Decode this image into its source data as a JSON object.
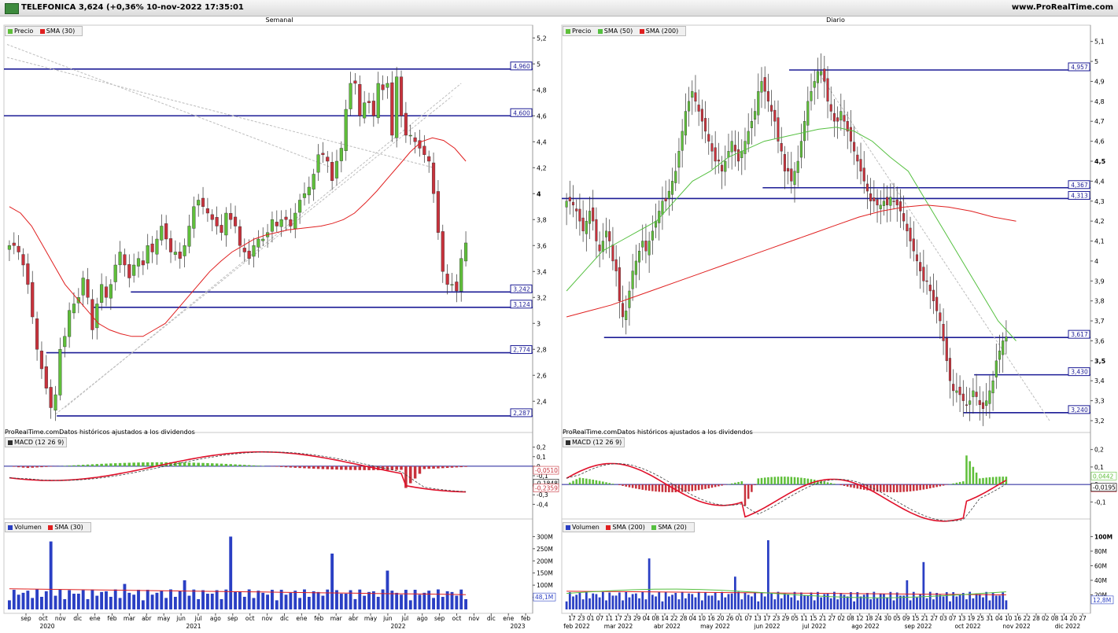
{
  "window": {
    "title": "TELEFONICA 3,624 (+0,36% 10-nov-2022 17:35:01",
    "site": "www.ProRealTime.com"
  },
  "colors": {
    "up": "#5fbf3a",
    "down": "#c8323c",
    "sma_red": "#e02020",
    "sma_green": "#55c040",
    "level_line": "#1c1c96",
    "trend_dotted": "#bdbdbd",
    "macd_line": "#e0102a",
    "signal_line": "#404040",
    "volume": "#2a3fc4"
  },
  "weekly": {
    "title": "Semanal",
    "legend": [
      {
        "label": "Precio",
        "color": "#5fbf3a"
      },
      {
        "label": "SMA (30)",
        "color": "#e02020"
      }
    ],
    "y_ticks": [
      "5,2",
      "5",
      "4,8",
      "4,6",
      "4,4",
      "4,2",
      "4",
      "3,8",
      "3,6",
      "3,4",
      "3,2",
      "3",
      "2,8",
      "2,6",
      "2,4"
    ],
    "levels": [
      "4,960",
      "4,600",
      "3,242",
      "3,124",
      "2,774",
      "2,287"
    ],
    "source": "ProRealTime.comDatos históricos ajustados a los dividendos",
    "macd_legend": "MACD (12 26 9)",
    "macd_ticks": [
      "0,2",
      "0,1",
      "0",
      "-0,1",
      "-0,2",
      "-0,3",
      "-0,4"
    ],
    "macd_values": [
      "-0,0510",
      "-0,1848",
      "-0,2359"
    ],
    "vol_legend": [
      {
        "label": "Volumen",
        "color": "#2a3fc4"
      },
      {
        "label": "SMA (30)",
        "color": "#e02020"
      }
    ],
    "vol_ticks": [
      "300M",
      "250M",
      "200M",
      "150M",
      "100M",
      "50M"
    ],
    "vol_value": "48,1M",
    "x_months": [
      "sep",
      "oct",
      "nov",
      "dic",
      "ene",
      "feb",
      "mar",
      "abr",
      "may",
      "jun",
      "jul",
      "ago",
      "sep",
      "oct",
      "nov",
      "dic",
      "ene",
      "feb",
      "mar",
      "abr",
      "may",
      "jun",
      "jul",
      "ago",
      "sep",
      "oct",
      "nov",
      "dic",
      "ene",
      "feb"
    ],
    "x_years": [
      "2020",
      "2021",
      "2022",
      "2023"
    ]
  },
  "daily": {
    "title": "Diario",
    "legend": [
      {
        "label": "Precio",
        "color": "#5fbf3a"
      },
      {
        "label": "SMA (50)",
        "color": "#55c040"
      },
      {
        "label": "SMA (200)",
        "color": "#e02020"
      }
    ],
    "y_ticks": [
      "5,1",
      "5",
      "4,9",
      "4,8",
      "4,7",
      "4,6",
      "4,5",
      "4,4",
      "4,3",
      "4,2",
      "4,1",
      "4",
      "3,9",
      "3,8",
      "3,7",
      "3,6",
      "3,5",
      "3,4",
      "3,3",
      "3,2"
    ],
    "levels": [
      "4,957",
      "4,367",
      "4,313",
      "3,617",
      "3,430",
      "3,240"
    ],
    "source": "ProRealTime.comDatos históricos ajustados a los dividendos",
    "macd_legend": "MACD (12 26 9)",
    "macd_ticks": [
      "0,2",
      "0,1",
      "0",
      "-0,1"
    ],
    "macd_values": [
      "0,0442",
      "-0,0247",
      "-0,0195"
    ],
    "vol_legend": [
      {
        "label": "Volumen",
        "color": "#2a3fc4"
      },
      {
        "label": "SMA (200)",
        "color": "#e02020"
      },
      {
        "label": "SMA (20)",
        "color": "#55c040"
      }
    ],
    "vol_ticks": [
      "100M",
      "80M",
      "60M",
      "40M",
      "20M"
    ],
    "vol_value": "12,8M",
    "x_days": [
      "17",
      "23",
      "01",
      "07",
      "11",
      "17",
      "23",
      "29",
      "04",
      "08",
      "14",
      "22",
      "28",
      "04",
      "10",
      "16",
      "20",
      "26",
      "01",
      "07",
      "13",
      "17",
      "23",
      "29",
      "05",
      "11",
      "15",
      "21",
      "27",
      "02",
      "08",
      "12",
      "18",
      "24",
      "30",
      "05",
      "09",
      "15",
      "21",
      "27",
      "03",
      "07",
      "13",
      "19",
      "25",
      "31",
      "04",
      "10",
      "16",
      "22",
      "28",
      "02",
      "08",
      "14",
      "20",
      "27"
    ],
    "x_months": [
      "feb 2022",
      "mar 2022",
      "abr 2022",
      "may 2022",
      "jun 2022",
      "jul 2022",
      "ago 2022",
      "sep 2022",
      "oct 2022",
      "nov 2022",
      "dic 2022"
    ]
  },
  "chart_data": [
    {
      "type": "candlestick",
      "title": "Semanal",
      "series": [
        {
          "name": "Precio",
          "values": [
            3.6,
            3.6,
            3.55,
            3.45,
            3.3,
            3.05,
            2.8,
            2.65,
            2.5,
            2.35,
            2.45,
            2.8,
            2.9,
            3.1,
            3.15,
            3.2,
            3.35,
            3.2,
            2.95,
            3.15,
            3.3,
            3.2,
            3.3,
            3.45,
            3.55,
            3.45,
            3.35,
            3.45,
            3.5,
            3.45,
            3.6,
            3.55,
            3.65,
            3.75,
            3.65,
            3.55,
            3.55,
            3.5,
            3.6,
            3.75,
            3.9,
            3.95,
            3.9,
            3.85,
            3.8,
            3.75,
            3.7,
            3.85,
            3.8,
            3.75,
            3.6,
            3.55,
            3.5,
            3.6,
            3.65,
            3.65,
            3.7,
            3.8,
            3.75,
            3.8,
            3.8,
            3.75,
            3.85,
            3.95,
            4,
            4.05,
            4.15,
            4.3,
            4.3,
            4.25,
            4.1,
            4.25,
            4.35,
            4.65,
            4.85,
            4.85,
            4.6,
            4.7,
            4.7,
            4.6,
            4.85,
            4.8,
            4.85,
            4.45,
            4.9,
            4.6,
            4.45,
            4.45,
            4.4,
            4.35,
            4.3,
            4.25,
            4.0,
            3.7,
            3.4,
            3.3,
            3.3,
            3.25,
            3.5,
            3.62
          ]
        },
        {
          "name": "SMA (30)",
          "values": [
            3.9,
            3.85,
            3.75,
            3.6,
            3.45,
            3.3,
            3.2,
            3.1,
            3.0,
            2.95,
            2.92,
            2.9,
            2.9,
            2.95,
            3.0,
            3.1,
            3.2,
            3.3,
            3.4,
            3.48,
            3.55,
            3.6,
            3.65,
            3.68,
            3.7,
            3.72,
            3.73,
            3.74,
            3.75,
            3.77,
            3.8,
            3.85,
            3.93,
            4.02,
            4.12,
            4.22,
            4.32,
            4.4,
            4.43,
            4.41,
            4.35,
            4.25
          ]
        }
      ],
      "levels": [
        4.96,
        4.6,
        3.242,
        3.124,
        2.774,
        2.287
      ],
      "ylim": [
        2.25,
        5.25
      ]
    },
    {
      "type": "candlestick",
      "title": "Diario",
      "series": [
        {
          "name": "Precio",
          "values": [
            4.3,
            4.3,
            4.28,
            4.25,
            4.2,
            4.15,
            4.2,
            4.25,
            4.2,
            4.1,
            4.05,
            4.1,
            4.15,
            4.1,
            4.0,
            3.95,
            3.8,
            3.72,
            3.75,
            3.85,
            3.95,
            4.0,
            4.05,
            4.1,
            4.05,
            4.1,
            4.15,
            4.2,
            4.25,
            4.3,
            4.3,
            4.35,
            4.4,
            4.45,
            4.55,
            4.65,
            4.75,
            4.8,
            4.85,
            4.8,
            4.75,
            4.7,
            4.65,
            4.6,
            4.55,
            4.5,
            4.5,
            4.45,
            4.5,
            4.55,
            4.6,
            4.55,
            4.5,
            4.55,
            4.6,
            4.65,
            4.7,
            4.75,
            4.85,
            4.9,
            4.85,
            4.8,
            4.75,
            4.7,
            4.6,
            4.55,
            4.45,
            4.45,
            4.4,
            4.45,
            4.5,
            4.6,
            4.7,
            4.8,
            4.85,
            4.9,
            4.95,
            4.95,
            4.9,
            4.8,
            4.75,
            4.7,
            4.7,
            4.75,
            4.7,
            4.65,
            4.6,
            4.55,
            4.5,
            4.45,
            4.4,
            4.35,
            4.3,
            4.3,
            4.28,
            4.28,
            4.3,
            4.28,
            4.32,
            4.3,
            4.28,
            4.25,
            4.2,
            4.15,
            4.1,
            4.05,
            4.0,
            3.95,
            3.9,
            3.9,
            3.85,
            3.8,
            3.75,
            3.7,
            3.6,
            3.5,
            3.4,
            3.35,
            3.35,
            3.33,
            3.3,
            3.28,
            3.3,
            3.35,
            3.32,
            3.28,
            3.26,
            3.3,
            3.35,
            3.4,
            3.5,
            3.55,
            3.6,
            3.62
          ]
        },
        {
          "name": "SMA (50)",
          "values": [
            3.85,
            3.95,
            4.05,
            4.1,
            4.15,
            4.2,
            4.3,
            4.4,
            4.45,
            4.52,
            4.56,
            4.6,
            4.62,
            4.64,
            4.66,
            4.67,
            4.65,
            4.6,
            4.52,
            4.45,
            4.3,
            4.15,
            4.0,
            3.85,
            3.7,
            3.6
          ]
        },
        {
          "name": "SMA (200)",
          "values": [
            3.72,
            3.75,
            3.78,
            3.82,
            3.86,
            3.9,
            3.94,
            3.98,
            4.02,
            4.06,
            4.1,
            4.14,
            4.18,
            4.22,
            4.25,
            4.27,
            4.28,
            4.27,
            4.25,
            4.22,
            4.2
          ]
        }
      ],
      "levels": [
        4.957,
        4.367,
        4.313,
        3.617,
        3.43,
        3.24
      ],
      "ylim": [
        3.2,
        5.15
      ]
    }
  ]
}
